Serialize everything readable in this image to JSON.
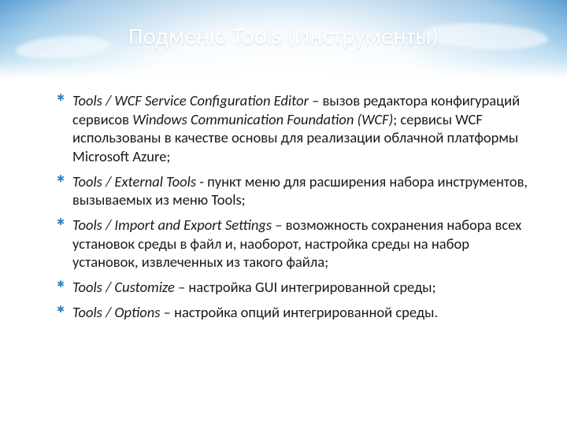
{
  "colors": {
    "accent": "#2f85c7",
    "title_text": "#ffffff",
    "body_text": "#1a1a1a"
  },
  "title": "Подменю Tools (Инструменты)",
  "items": [
    {
      "lead": "Tools / WCF Service Configuration Editor",
      "tail": " – вызов редактора конфигураций сервисов ",
      "lead2": "Windows Communication Foundation (WCF)",
      "tail2": "; сервисы WCF использованы в качестве основы для реализации облачной платформы Microsoft Azure;"
    },
    {
      "lead": "Tools / External Tools",
      "tail": "  - пункт меню для расширения набора инструментов, вызываемых из меню Tools;"
    },
    {
      "lead": "Tools / Import and Export Settings",
      "tail": " – возможность сохранения набора всех установок среды в файл и, наоборот, настройка среды на набор установок, извлеченных из такого файла;"
    },
    {
      "lead": "Tools / Customize",
      "tail": " – настройка GUI интегрированной среды;"
    },
    {
      "lead": "Tools / Options",
      "tail": " – настройка опций интегрированной среды."
    }
  ]
}
